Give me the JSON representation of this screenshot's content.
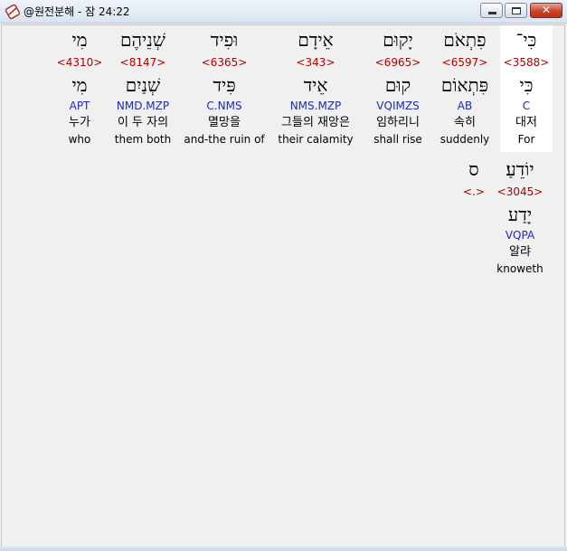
{
  "window": {
    "title": "@원전분해 - 잠 24:22",
    "close_symbol": "✕"
  },
  "words": [
    {
      "heb": "כִּי־",
      "strong": "<3588>",
      "lemma": "כִּי",
      "morph": "C",
      "korean": "대저",
      "english": "For"
    },
    {
      "heb": "פִתְאֹם",
      "strong": "<6597>",
      "lemma": "פִּתְאוֹם",
      "morph": "AB",
      "korean": "속히",
      "english": "suddenly"
    },
    {
      "heb": "יָקוּם",
      "strong": "<6965>",
      "lemma": "קוּם",
      "morph": "VQIMZS",
      "korean": "임하리니",
      "english": "shall rise"
    },
    {
      "heb": "אֵידָם",
      "strong": "<343>",
      "lemma": "אֵיד",
      "morph": "NMS.MZP",
      "korean": "그들의 재앙은",
      "english": "their calamity"
    },
    {
      "heb": "וּפִיד",
      "strong": "<6365>",
      "lemma": "פִּיד",
      "morph": "C.NMS",
      "korean": "멸망을",
      "english": "and-the ruin of"
    },
    {
      "heb": "שְׁנֵיהֶם",
      "strong": "<8147>",
      "lemma": "שְׁנַיִם",
      "morph": "NMD.MZP",
      "korean": "이 두 자의",
      "english": "them both"
    },
    {
      "heb": "מִי",
      "strong": "<4310>",
      "lemma": "מִי",
      "morph": "APT",
      "korean": "누가",
      "english": "who"
    },
    {
      "heb": "יוֹדֵעַ׃",
      "strong": "<3045>",
      "lemma": "יָדַע",
      "morph": "VQPA",
      "korean": "알랴",
      "english": "knoweth"
    },
    {
      "heb": "ס",
      "strong": "<.>",
      "lemma": "",
      "morph": "",
      "korean": "",
      "english": ""
    }
  ]
}
